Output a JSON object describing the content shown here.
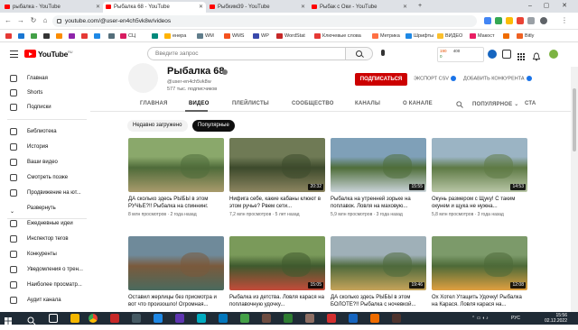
{
  "browser": {
    "tabs": [
      {
        "title": "рыбалка - YouTube",
        "active": false
      },
      {
        "title": "Рыбалка 68 - YouTube",
        "active": true
      },
      {
        "title": "Рыбхим39 - YouTube",
        "active": false
      },
      {
        "title": "Рыбак с Оки - YouTube",
        "active": false
      }
    ],
    "new_tab": "+",
    "url": "youtube.com/@user-en4ch5vk8w/videos",
    "bookmarks": [
      "СЦ",
      "енера",
      "WM",
      "WMS",
      "WP",
      "WordStat",
      "Ключевые слова",
      "Метрика",
      "Шрифты",
      "ВИДЕО",
      "Макост",
      "Bitly"
    ],
    "extension_badges": [
      "190",
      "0",
      "400"
    ]
  },
  "youtube": {
    "logo_text": "YouTube",
    "logo_sup": "RU",
    "search_placeholder": "Введите запрос",
    "sidebar": [
      {
        "label": "Главная",
        "icon": "home-icon"
      },
      {
        "label": "Shorts",
        "icon": "shorts-icon"
      },
      {
        "label": "Подписки",
        "icon": "subscriptions-icon"
      },
      {
        "label": "Библиотека",
        "icon": "library-icon"
      },
      {
        "label": "История",
        "icon": "history-icon"
      },
      {
        "label": "Ваши видео",
        "icon": "your-videos-icon"
      },
      {
        "label": "Смотреть позже",
        "icon": "watch-later-icon"
      },
      {
        "label": "Продвижение на ют...",
        "icon": "playlist-icon"
      },
      {
        "label": "Развернуть",
        "icon": "chevron-down-icon"
      },
      {
        "label": "Ежедневные идеи",
        "icon": "playlist-icon"
      },
      {
        "label": "Инспектор тегов",
        "icon": "tag-icon"
      },
      {
        "label": "Конкуренты",
        "icon": "competitors-icon"
      },
      {
        "label": "Уведомления о трен...",
        "icon": "bell-icon"
      },
      {
        "label": "Наиболее просматр...",
        "icon": "trending-icon"
      },
      {
        "label": "Аудит канала",
        "icon": "audit-icon"
      }
    ],
    "channel": {
      "name": "Рыбалка 68",
      "handle": "@user-en4ch5vk8w",
      "subscribers": "577 тыс. подписчиков",
      "subscribe_label": "ПОДПИСАТЬСЯ",
      "export_label": "ЭКСПОРТ CSV",
      "add_competitor_label": "ДОБАВИТЬ КОНКУРЕНТА"
    },
    "channel_tabs": [
      "ГЛАВНАЯ",
      "ВИДЕО",
      "ПЛЕЙЛИСТЫ",
      "СООБЩЕСТВО",
      "КАНАЛЫ",
      "О КАНАЛЕ",
      "ПОПУЛЯРНОЕ",
      "СТА"
    ],
    "active_tab": "ВИДЕО",
    "filters": [
      {
        "label": "Недавно загружено",
        "active": false
      },
      {
        "label": "Популярные",
        "active": true
      }
    ],
    "videos": [
      {
        "title": "ДА сколько здесь РЫБЫ в этом РУЧЬЕ?!! Рыбалка на спиннинг.",
        "meta": "8 млн просмотров · 2 года назад",
        "duration": "",
        "palette": [
          "#8aa86b",
          "#4f6b3a",
          "#a99b6c"
        ]
      },
      {
        "title": "Нифига себе, какие кабаны клюют в этом ручье? Рвем сети...",
        "meta": "7,2 млн просмотров · 5 лет назад",
        "duration": "20:32",
        "palette": [
          "#6f7a55",
          "#3d4a2c",
          "#8c8560"
        ]
      },
      {
        "title": "Рыбалка на утренней зорьке на поплавок. Ловля на маховую...",
        "meta": "5,9 млн просмотров · 3 года назад",
        "duration": "15:55",
        "palette": [
          "#7fa0b8",
          "#4f6e3a",
          "#c9d3d8"
        ]
      },
      {
        "title": "Окунь размером с Щуку! С таким окунем и щука не нужна...",
        "meta": "5,8 млн просмотров · 3 года назад",
        "duration": "14:53",
        "palette": [
          "#9bb4c4",
          "#5e7a45",
          "#b8c6a6"
        ]
      },
      {
        "title": "Оставил жерлицы без присмотра и вот что произошло! Огромная...",
        "meta": "",
        "duration": "",
        "palette": [
          "#6f8a9a",
          "#7a5a3c",
          "#4a6a5e"
        ]
      },
      {
        "title": "Рыбалка из детства. Ловля карася на поплавочную удочку...",
        "meta": "",
        "duration": "15:05",
        "palette": [
          "#7a9a5a",
          "#3f5a2e",
          "#c44b3a"
        ]
      },
      {
        "title": "ДА сколько здесь РЫБЫ в этом БОЛОТЕ?!! Рыбалка с ночевкой...",
        "meta": "",
        "duration": "19:46",
        "palette": [
          "#9fb0b8",
          "#4e6a3c",
          "#c6a45a"
        ]
      },
      {
        "title": "Ох Хотел Утащить Удочку! Рыбалка на Карася. Ловля карася на...",
        "meta": "",
        "duration": "12:08",
        "palette": [
          "#7c9a6a",
          "#4d6a38",
          "#e0a040"
        ]
      }
    ]
  },
  "taskbar": {
    "lang": "РУС",
    "time": "15:56",
    "date": "02.12.2022"
  }
}
